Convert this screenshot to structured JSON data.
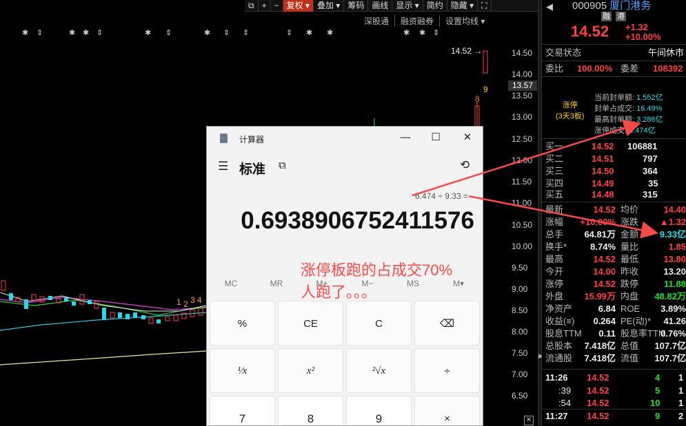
{
  "toolbar": {
    "items": [
      "+",
      "−",
      "复权 ▾",
      "叠加 ▾",
      "筹码",
      "画线",
      "显示 ▾",
      "简约",
      "隐藏 ▾"
    ],
    "subbar": [
      "深股通",
      "融资融券",
      "设置均线 ▾"
    ]
  },
  "axis": {
    "ticks": [
      "14.50",
      "14.00",
      "13.50",
      "13.00",
      "12.50",
      "12.00",
      "11.50",
      "11.00",
      "10.50",
      "10.00",
      "9.50",
      "9.00",
      "8.50",
      "8.00",
      "7.50",
      "7.00",
      "6.50"
    ],
    "highlight": "13.57",
    "last_price_label": "14.52 →",
    "counter_labels": [
      "9",
      "8"
    ],
    "small_labels": [
      "1",
      "2",
      "3",
      "4"
    ]
  },
  "stock": {
    "code": "000905",
    "name": "厦门港务",
    "tags": [
      "融",
      "港"
    ],
    "price": "14.52",
    "change": "+1.32",
    "change_pct": "+10.00%"
  },
  "status": {
    "trade_label": "交易状态",
    "trade_value": "午间休市",
    "wb_label": "委比",
    "wb_value": "100.00%",
    "wc_label": "委差",
    "wc_value": "108392"
  },
  "limit_info": {
    "title": "涨停",
    "subtitle": "(3天3板)",
    "lines": [
      {
        "label": "当前封单额:",
        "value": "1.552亿"
      },
      {
        "label": "封单占成交:",
        "value": "16.49%"
      },
      {
        "label": "最高封单额:",
        "value": "3.286亿"
      },
      {
        "label": "涨停成交:",
        "value": "6.474亿"
      }
    ]
  },
  "order_book": [
    {
      "label": "买一",
      "price": "14.52",
      "vol": "106881"
    },
    {
      "label": "买二",
      "price": "14.51",
      "vol": "797"
    },
    {
      "label": "买三",
      "price": "14.50",
      "vol": "364"
    },
    {
      "label": "买四",
      "price": "14.49",
      "vol": "35"
    },
    {
      "label": "买五",
      "price": "14.48",
      "vol": "315"
    }
  ],
  "stats": [
    {
      "l1": "最新",
      "v1": "14.52",
      "c1": "red",
      "l2": "均价",
      "v2": "14.40",
      "c2": "red"
    },
    {
      "l1": "涨幅",
      "v1": "+10.00%",
      "c1": "red",
      "l2": "涨跌",
      "v2": "▲1.32",
      "c2": "red"
    },
    {
      "l1": "总手",
      "v1": "64.81万",
      "c1": "white",
      "l2": "金额",
      "v2": "9.33亿",
      "c2": "cyan"
    },
    {
      "l1": "换手*",
      "v1": "8.74%",
      "c1": "white",
      "l2": "量比",
      "v2": "1.85",
      "c2": "red"
    },
    {
      "l1": "最高",
      "v1": "14.52",
      "c1": "red",
      "l2": "最低",
      "v2": "13.80",
      "c2": "red"
    },
    {
      "l1": "今开",
      "v1": "14.00",
      "c1": "red",
      "l2": "昨收",
      "v2": "13.20",
      "c2": "white"
    },
    {
      "l1": "涨停",
      "v1": "14.52",
      "c1": "red",
      "l2": "跌停",
      "v2": "11.88",
      "c2": "green"
    },
    {
      "l1": "外盘",
      "v1": "15.99万",
      "c1": "red",
      "l2": "内盘",
      "v2": "48.82万",
      "c2": "green"
    },
    {
      "l1": "净资产",
      "v1": "6.84",
      "c1": "white",
      "l2": "ROE",
      "v2": "3.89%",
      "c2": "white"
    },
    {
      "l1": "收益(≡)",
      "v1": "0.264",
      "c1": "white",
      "l2": "PE(动)*",
      "v2": "41.26",
      "c2": "white"
    },
    {
      "l1": "股息TTM",
      "v1": "0.11",
      "c1": "white",
      "l2": "股息率TTM",
      "v2": "0.76%",
      "c2": "white"
    },
    {
      "l1": "总股本",
      "v1": "7.418亿",
      "c1": "white",
      "l2": "总值",
      "v2": "107.7亿",
      "c2": "white"
    },
    {
      "l1": "流通股",
      "v1": "7.418亿",
      "c1": "white",
      "l2": "流值",
      "v2": "107.7亿",
      "c2": "white"
    }
  ],
  "ticks": [
    {
      "time": "11:26",
      "price": "14.52",
      "vol": "4",
      "n": "1"
    },
    {
      "time": ":39",
      "price": "14.52",
      "vol": "5",
      "n": "1"
    },
    {
      "time": ":54",
      "price": "14.52",
      "vol": "10",
      "n": "1"
    },
    {
      "time": "11:27",
      "price": "14.52",
      "vol": "9",
      "n": "2"
    }
  ],
  "calculator": {
    "title": "计算器",
    "mode": "标准",
    "expression": "6.474 ÷ 9.33 =",
    "result": "0.6938906752411576",
    "memory": [
      "MC",
      "MR",
      "M+",
      "M−",
      "MS",
      "M▾"
    ],
    "keys": [
      "%",
      "CE",
      "C",
      "⌫",
      "¹⁄x",
      "x²",
      "²√x",
      "÷",
      "7",
      "8",
      "9",
      "×"
    ]
  },
  "annotation": {
    "line1": "涨停板跑的占成交70%",
    "line2": "人跑了。。。"
  },
  "colors": {
    "up": "#ff4040",
    "down": "#22e022",
    "accent": "#c03018",
    "amount": "#28e0e8"
  }
}
